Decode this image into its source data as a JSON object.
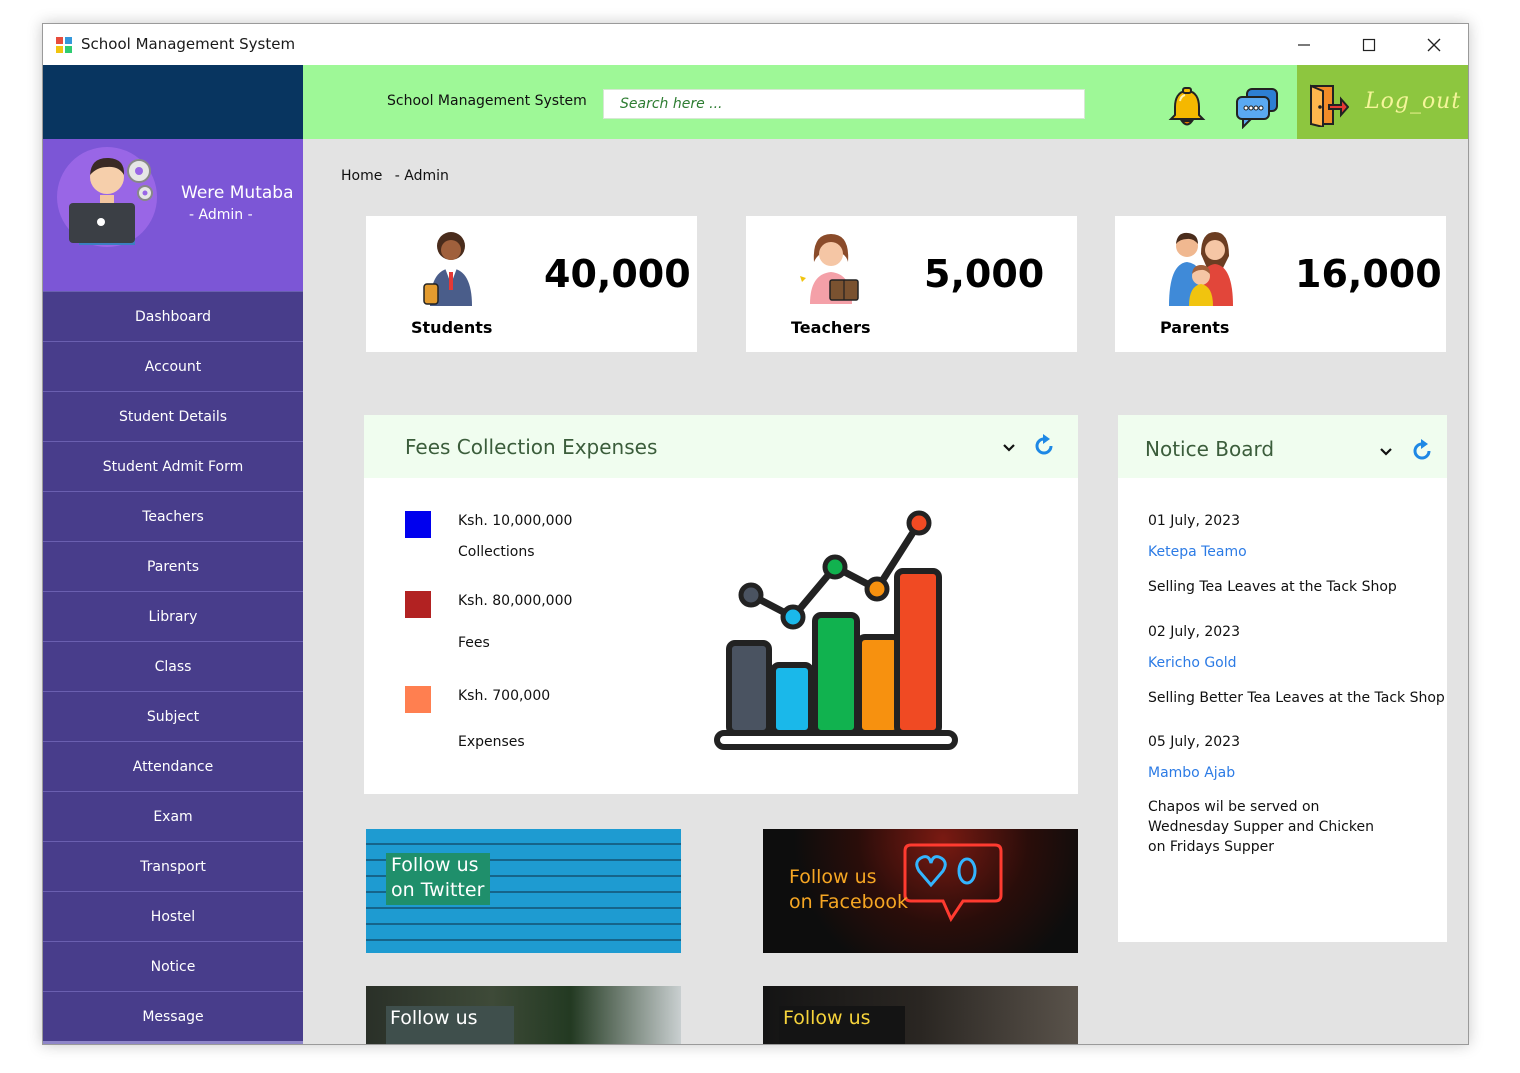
{
  "window": {
    "title": "School Management System",
    "controls": [
      "minimize-icon",
      "maximize-icon",
      "close-icon"
    ]
  },
  "topbar": {
    "title": "School Management System",
    "search_placeholder": "Search here ...",
    "icons": [
      "bell-icon",
      "chat-icon"
    ],
    "logout_label": "Log_out",
    "bg_color": "#9ef897",
    "logout_bg": "#8dc63f"
  },
  "profile": {
    "name": "Were Mutaba",
    "role": "- Admin -",
    "bg_color": "#7c56d6"
  },
  "sidebar": {
    "bg_color": "#483d8b",
    "items": [
      {
        "label": "Dashboard"
      },
      {
        "label": "Account"
      },
      {
        "label": "Student Details"
      },
      {
        "label": "Student Admit Form"
      },
      {
        "label": "Teachers"
      },
      {
        "label": "Parents"
      },
      {
        "label": "Library"
      },
      {
        "label": "Class"
      },
      {
        "label": "Subject"
      },
      {
        "label": "Attendance"
      },
      {
        "label": "Exam"
      },
      {
        "label": "Transport"
      },
      {
        "label": "Hostel"
      },
      {
        "label": "Notice"
      },
      {
        "label": "Message"
      }
    ]
  },
  "breadcrumb": [
    "Home",
    "- Admin"
  ],
  "stats": [
    {
      "label": "Students",
      "value": "40,000",
      "icon": "student-icon"
    },
    {
      "label": "Teachers",
      "value": "5,000",
      "icon": "teacher-icon"
    },
    {
      "label": "Parents",
      "value": "16,000",
      "icon": "parents-icon"
    }
  ],
  "fees": {
    "title": "Fees Collection Expenses",
    "items": [
      {
        "amount": "Ksh. 10,000,000",
        "label": "Collections",
        "color": "#0000ee"
      },
      {
        "amount": "Ksh. 80,000,000",
        "label": "Fees",
        "color": "#b22222"
      },
      {
        "amount": "Ksh. 700,000",
        "label": "Expenses",
        "color": "#ff7f50"
      }
    ]
  },
  "notice_board": {
    "title": "Notice Board",
    "notices": [
      {
        "date": "01 July, 2023",
        "author": "Ketepa Teamo",
        "body": "Selling Tea Leaves at the Tack Shop"
      },
      {
        "date": "02 July, 2023",
        "author": "Kericho Gold",
        "body": "Selling Better Tea Leaves at the Tack Shop"
      },
      {
        "date": "05 July, 2023",
        "author": "Mambo Ajab",
        "body_lines": [
          "Chapos wil be served on",
          "Wednesday Supper and Chicken",
          "on Fridays Supper"
        ]
      }
    ]
  },
  "social": [
    {
      "lines": [
        "Follow us",
        "on Twitter"
      ]
    },
    {
      "lines": [
        "Follow us",
        "on Facebook"
      ]
    },
    {
      "lines": [
        "Follow us"
      ]
    },
    {
      "lines": [
        "Follow us"
      ]
    }
  ]
}
